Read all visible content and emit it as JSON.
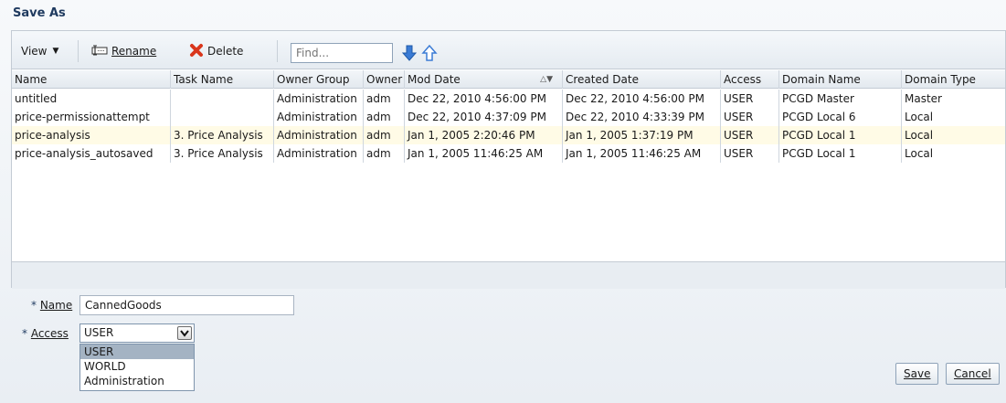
{
  "dialog": {
    "title": "Save As"
  },
  "toolbar": {
    "view_label": "View",
    "rename_label": "Rename",
    "delete_label": "Delete",
    "find_placeholder": "Find..."
  },
  "table": {
    "columns": [
      "Name",
      "Task Name",
      "Owner Group",
      "Owner",
      "Mod Date",
      "Created Date",
      "Access",
      "Domain Name",
      "Domain Type"
    ],
    "rows": [
      [
        "untitled",
        "",
        "Administration",
        "adm",
        "Dec 22, 2010 4:56:00 PM",
        "Dec 22, 2010 4:56:00 PM",
        "USER",
        "PCGD Master",
        "Master"
      ],
      [
        "price-permissionattempt",
        "",
        "Administration",
        "adm",
        "Dec 22, 2010 4:37:09 PM",
        "Dec 22, 2010 4:33:39 PM",
        "USER",
        "PCGD Local 6",
        "Local"
      ],
      [
        "price-analysis",
        "3. Price Analysis",
        "Administration",
        "adm",
        "Jan 1, 2005 2:20:46 PM",
        "Jan 1, 2005 1:37:19 PM",
        "USER",
        "PCGD Local 1",
        "Local"
      ],
      [
        "price-analysis_autosaved",
        "3. Price Analysis",
        "Administration",
        "adm",
        "Jan 1, 2005 11:46:25 AM",
        "Jan 1, 2005 11:46:25 AM",
        "USER",
        "PCGD Local 1",
        "Local"
      ]
    ]
  },
  "form": {
    "name_label": "Name",
    "name_value": "CannedGoods",
    "access_label": "Access",
    "access_value": "USER",
    "access_options": [
      "USER",
      "WORLD",
      "Administration"
    ],
    "required_marker": "*"
  },
  "buttons": {
    "save": "Save",
    "cancel": "Cancel"
  },
  "colors": {
    "title": "#1f3a5f",
    "highlight_row": "#fffbe6",
    "selected_option": "#a4b3c3",
    "delete_icon": "#d9361c",
    "arrow_icons": "#3a7bd5"
  }
}
